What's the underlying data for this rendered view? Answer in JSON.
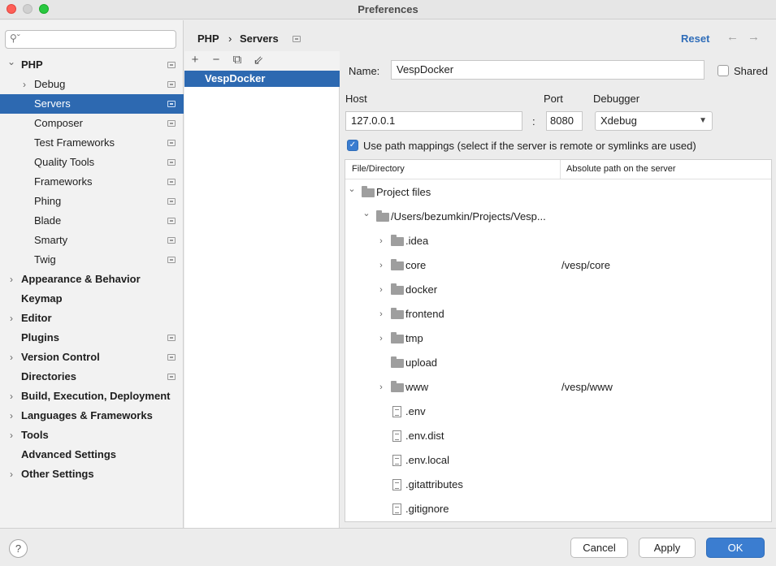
{
  "window": {
    "title": "Preferences"
  },
  "sidebar": {
    "search_placeholder": "",
    "items": [
      {
        "label": "PHP",
        "level": 0,
        "bold": true,
        "expanded": true,
        "has_children": true,
        "project": true
      },
      {
        "label": "Debug",
        "level": 1,
        "has_children": true,
        "project": true
      },
      {
        "label": "Servers",
        "level": 1,
        "selected": true,
        "project": true
      },
      {
        "label": "Composer",
        "level": 1,
        "project": true
      },
      {
        "label": "Test Frameworks",
        "level": 1,
        "project": true
      },
      {
        "label": "Quality Tools",
        "level": 1,
        "project": true
      },
      {
        "label": "Frameworks",
        "level": 1,
        "project": true
      },
      {
        "label": "Phing",
        "level": 1,
        "project": true
      },
      {
        "label": "Blade",
        "level": 1,
        "project": true
      },
      {
        "label": "Smarty",
        "level": 1,
        "project": true
      },
      {
        "label": "Twig",
        "level": 1,
        "project": true
      },
      {
        "label": "Appearance & Behavior",
        "level": 0,
        "bold": true,
        "has_children": true
      },
      {
        "label": "Keymap",
        "level": 0,
        "bold": true
      },
      {
        "label": "Editor",
        "level": 0,
        "bold": true,
        "has_children": true
      },
      {
        "label": "Plugins",
        "level": 0,
        "bold": true,
        "project": true
      },
      {
        "label": "Version Control",
        "level": 0,
        "bold": true,
        "has_children": true,
        "project": true
      },
      {
        "label": "Directories",
        "level": 0,
        "bold": true,
        "project": true
      },
      {
        "label": "Build, Execution, Deployment",
        "level": 0,
        "bold": true,
        "has_children": true
      },
      {
        "label": "Languages & Frameworks",
        "level": 0,
        "bold": true,
        "has_children": true
      },
      {
        "label": "Tools",
        "level": 0,
        "bold": true,
        "has_children": true
      },
      {
        "label": "Advanced Settings",
        "level": 0,
        "bold": true
      },
      {
        "label": "Other Settings",
        "level": 0,
        "bold": true,
        "has_children": true
      }
    ]
  },
  "header": {
    "breadcrumb": [
      "PHP",
      "Servers"
    ],
    "separator": "›",
    "reset_label": "Reset",
    "back_arrow": "←",
    "forward_arrow": "→"
  },
  "servers": {
    "tools": [
      "+",
      "−",
      "⧉",
      "⇙"
    ],
    "list": [
      "VespDocker"
    ]
  },
  "form": {
    "name_label": "Name:",
    "name_value": "VespDocker",
    "shared_label": "Shared",
    "host_label": "Host",
    "host_value": "127.0.0.1",
    "colon": ":",
    "port_label": "Port",
    "port_value": "8080",
    "debugger_label": "Debugger",
    "debugger_value": "Xdebug",
    "use_path_mappings_label": "Use path mappings (select if the server is remote or symlinks are used)"
  },
  "mappings": {
    "columns": [
      "File/Directory",
      "Absolute path on the server"
    ],
    "rows": [
      {
        "name": "Project files",
        "level": 0,
        "type": "folder",
        "chevron": "down",
        "path": ""
      },
      {
        "name": "/Users/bezumkin/Projects/Vesp...",
        "level": 1,
        "type": "folder",
        "chevron": "down",
        "path": ""
      },
      {
        "name": ".idea",
        "level": 2,
        "type": "folder",
        "chevron": "right",
        "path": ""
      },
      {
        "name": "core",
        "level": 2,
        "type": "folder",
        "chevron": "right",
        "path": "/vesp/core"
      },
      {
        "name": "docker",
        "level": 2,
        "type": "folder",
        "chevron": "right",
        "path": ""
      },
      {
        "name": "frontend",
        "level": 2,
        "type": "folder",
        "chevron": "right",
        "path": ""
      },
      {
        "name": "tmp",
        "level": 2,
        "type": "folder",
        "chevron": "right",
        "path": ""
      },
      {
        "name": "upload",
        "level": 2,
        "type": "folder",
        "chevron": "",
        "path": ""
      },
      {
        "name": "www",
        "level": 2,
        "type": "folder",
        "chevron": "right",
        "path": "/vesp/www"
      },
      {
        "name": ".env",
        "level": 2,
        "type": "file",
        "chevron": "",
        "path": ""
      },
      {
        "name": ".env.dist",
        "level": 2,
        "type": "file",
        "chevron": "",
        "path": ""
      },
      {
        "name": ".env.local",
        "level": 2,
        "type": "file",
        "chevron": "",
        "path": ""
      },
      {
        "name": ".gitattributes",
        "level": 2,
        "type": "file",
        "chevron": "",
        "path": ""
      },
      {
        "name": ".gitignore",
        "level": 2,
        "type": "file",
        "chevron": "",
        "path": ""
      }
    ]
  },
  "footer": {
    "help_label": "?",
    "cancel_label": "Cancel",
    "apply_label": "Apply",
    "ok_label": "OK"
  }
}
